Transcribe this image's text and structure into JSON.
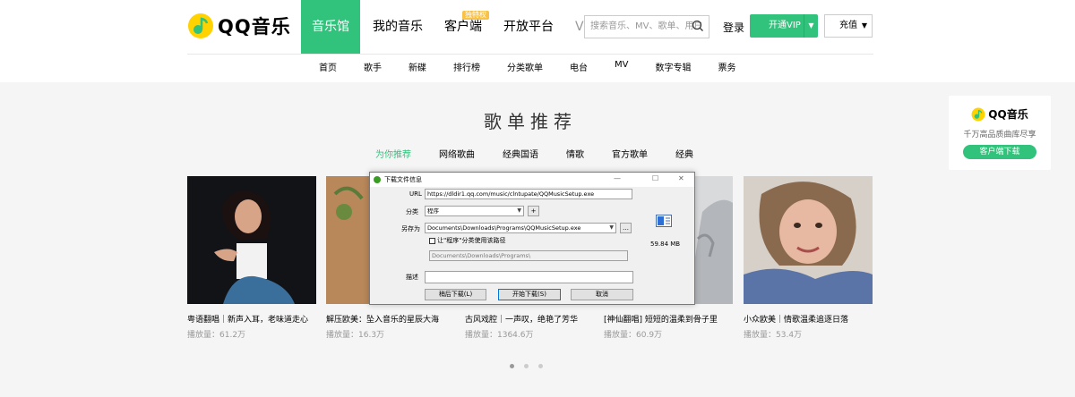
{
  "header": {
    "logo_text": "QQ音乐",
    "nav": [
      {
        "label": "音乐馆",
        "active": true
      },
      {
        "label": "我的音乐"
      },
      {
        "label": "客户端",
        "badge": "独特权"
      },
      {
        "label": "开放平台"
      },
      {
        "label": "VIP"
      }
    ],
    "search_placeholder": "搜索音乐、MV、歌单、用户",
    "login": "登录",
    "vip_button": "开通VIP",
    "charge_button": "充值",
    "subnav": [
      "首页",
      "歌手",
      "新碟",
      "排行榜",
      "分类歌单",
      "电台",
      "MV",
      "数字专辑",
      "票务"
    ]
  },
  "section": {
    "title": "歌单推荐",
    "tabs": [
      "为你推荐",
      "网络歌曲",
      "经典国语",
      "情歌",
      "官方歌单",
      "经典"
    ]
  },
  "playlists": [
    {
      "title": "粤语翻唱｜新声入耳，老味道走心",
      "plays": "播放量：61.2万"
    },
    {
      "title": "解压欧美：坠入音乐的星辰大海",
      "plays": "播放量：16.3万"
    },
    {
      "title": "古风戏腔｜一声叹，绝艳了芳华",
      "plays": "播放量：1364.6万"
    },
    {
      "title": "[神仙翻唱] 短短的温柔到骨子里",
      "plays": "播放量：60.9万"
    },
    {
      "title": "小众欧美｜情歌温柔追逐日落",
      "plays": "播放量：53.4万"
    }
  ],
  "side_ad": {
    "logo_text": "QQ音乐",
    "desc": "千万高品质曲库尽享",
    "button": "客户端下载"
  },
  "dialog": {
    "title": "下载文件信息",
    "url_label": "URL",
    "url_value": "https://dldir1.qq.com/music/clntupate/QQMusicSetup.exe",
    "category_label": "分类",
    "category_value": "程序",
    "save_label": "另存为",
    "save_value": "Documents\\Downloads\\Programs\\QQMusicSetup.exe",
    "checkbox_label": "让\"程序\"分类使用该路径",
    "path_value": "Documents\\Downloads\\Programs\\",
    "desc_label": "描述",
    "file_size": "59.84 MB",
    "btn_later": "稍后下载(L)",
    "btn_start": "开始下载(S)",
    "btn_cancel": "取消",
    "ctrl_min": "—",
    "ctrl_max": "☐",
    "ctrl_close": "✕"
  },
  "colors": {
    "accent": "#31c27c",
    "badge": "#f7c247"
  }
}
